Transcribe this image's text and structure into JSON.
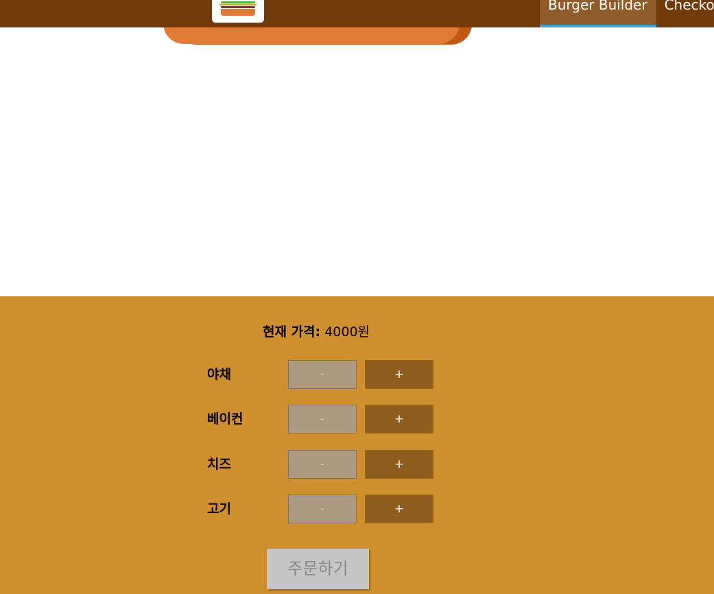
{
  "toolbar": {
    "nav_items": [
      {
        "label": "Burger Builder"
      },
      {
        "label": "Checkout"
      }
    ]
  },
  "build_controls": {
    "price_label": "현재 가격:",
    "price_value": "4000원",
    "ingredients": [
      {
        "label": "야채",
        "less_label": "-",
        "more_label": "+"
      },
      {
        "label": "베이컨",
        "less_label": "-",
        "more_label": "+"
      },
      {
        "label": "치즈",
        "less_label": "-",
        "more_label": "+"
      },
      {
        "label": "고기",
        "less_label": "-",
        "more_label": "+"
      }
    ],
    "order_label": "주문하기"
  },
  "colors": {
    "toolbar_bg": "#703b09",
    "active_nav_bg": "#8f5c2c",
    "active_nav_border": "#40a4c8",
    "controls_bg": "#cf8f2e",
    "bun": "#e27b36",
    "more_button_bg": "#8f5e1e",
    "less_button_bg": "#ac9980",
    "order_button_bg": "#c7c6c6"
  }
}
